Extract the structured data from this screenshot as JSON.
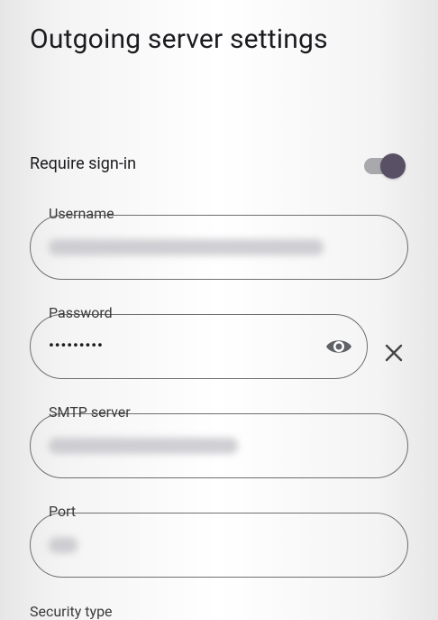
{
  "page": {
    "title": "Outgoing server settings"
  },
  "require_signin": {
    "label": "Require sign-in",
    "enabled": true
  },
  "fields": {
    "username": {
      "label": "Username"
    },
    "password": {
      "label": "Password",
      "value": "•••••••••"
    },
    "smtp": {
      "label": "SMTP server"
    },
    "port": {
      "label": "Port"
    }
  },
  "bottom": {
    "label": "Security type"
  },
  "colors": {
    "track": "#a9a9ad",
    "thumb": "#5a5066",
    "outline": "#6f6f6f"
  }
}
